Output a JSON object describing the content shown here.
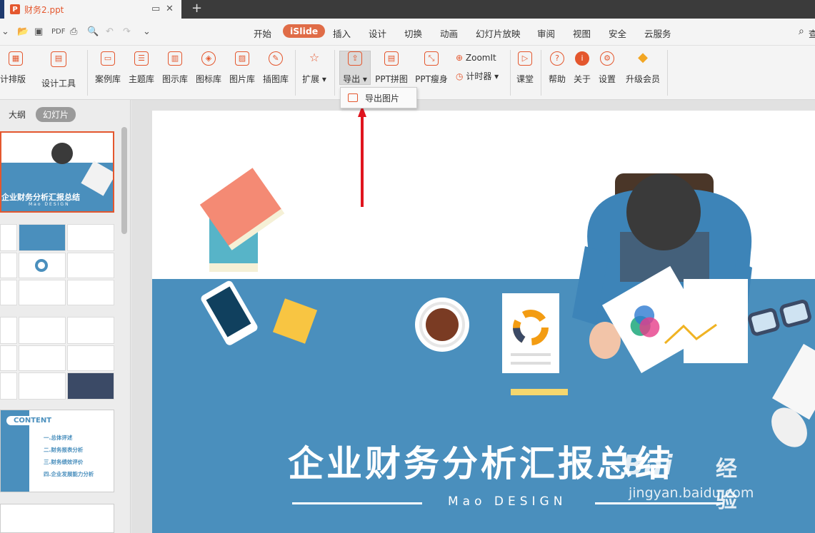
{
  "titlebar": {
    "doc_badge": "P",
    "doc_title": "财务2.ppt",
    "new_tab": "+",
    "close": "✕"
  },
  "menu": {
    "items": [
      "开始",
      "iSlide",
      "插入",
      "设计",
      "切换",
      "动画",
      "幻灯片放映",
      "审阅",
      "视图",
      "安全",
      "云服务"
    ],
    "search_label": "查"
  },
  "ribbon": {
    "layout_label": "计排版",
    "design_tools_label": "设计工具",
    "case_lib": "案例库",
    "theme_lib": "主题库",
    "chart_lib": "图示库",
    "icon_lib": "图标库",
    "image_lib": "图片库",
    "illus_lib": "插图库",
    "extend": "扩展",
    "export": "导出",
    "ppt_collage": "PPT拼图",
    "ppt_slim": "PPT瘦身",
    "zoomit": "ZoomIt",
    "timer": "计时器",
    "classroom": "课堂",
    "help": "帮助",
    "about": "关于",
    "settings": "设置",
    "upgrade": "升级会员"
  },
  "dropdown": {
    "export_image": "导出图片"
  },
  "panel": {
    "tab_outline": "大纲",
    "tab_slides": "幻灯片",
    "thumb1_title": "企业财务分析汇报总结",
    "thumb1_sub": "Mao DESIGN",
    "thumb_content_title": "CONTENT",
    "content_items": [
      "一.总体评述",
      "二.财务报表分析",
      "三.财务绩效评价",
      "四.企业发展能力分析"
    ]
  },
  "slide": {
    "title": "企业财务分析汇报总结",
    "subtitle": "Mao DESIGN"
  },
  "watermark": {
    "brand": "Bai",
    "brand2": "经验",
    "url": "jingyan.baidu.com"
  },
  "colors": {
    "accent": "#e4572e",
    "slide_blue": "#4a8fbd",
    "arrow": "#e0141e"
  }
}
